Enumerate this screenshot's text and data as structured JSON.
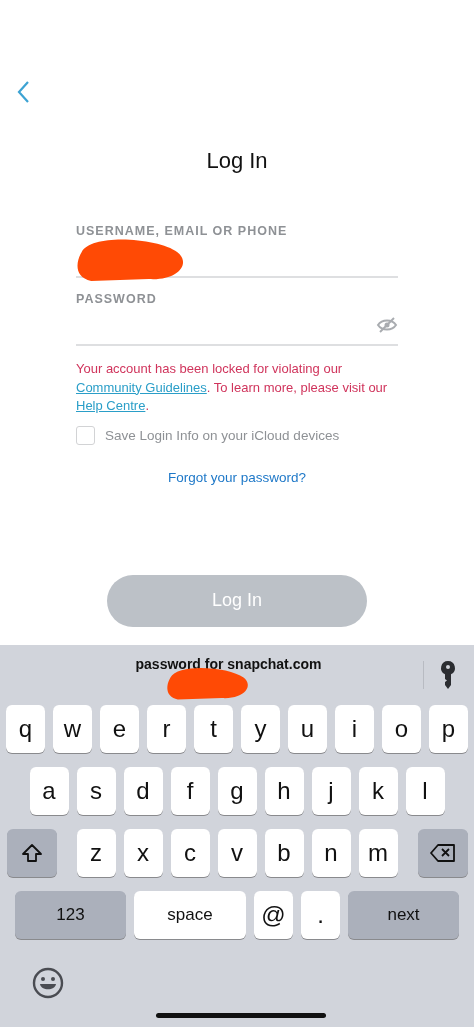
{
  "title": "Log In",
  "username": {
    "label": "USERNAME, EMAIL OR PHONE",
    "redacted": true
  },
  "password": {
    "label": "PASSWORD",
    "visible": false
  },
  "error": {
    "parts": [
      {
        "kind": "text",
        "text": "Your account has been locked for violating our "
      },
      {
        "kind": "link",
        "text": "Community Guidelines"
      },
      {
        "kind": "text",
        "text": ". To learn more, please visit our "
      },
      {
        "kind": "link",
        "text": "Help Centre"
      },
      {
        "kind": "text",
        "text": "."
      }
    ]
  },
  "save_login": {
    "label": "Save Login Info on your iCloud devices",
    "checked": false
  },
  "forgot_link": "Forgot your password?",
  "login_button": {
    "label": "Log In",
    "disabled": true
  },
  "keyboard": {
    "suggestion": "password for snapchat.com",
    "suggestion_redacted": true,
    "rows": [
      [
        {
          "kind": "letter",
          "label": "q"
        },
        {
          "kind": "letter",
          "label": "w"
        },
        {
          "kind": "letter",
          "label": "e"
        },
        {
          "kind": "letter",
          "label": "r"
        },
        {
          "kind": "letter",
          "label": "t"
        },
        {
          "kind": "letter",
          "label": "y"
        },
        {
          "kind": "letter",
          "label": "u"
        },
        {
          "kind": "letter",
          "label": "i"
        },
        {
          "kind": "letter",
          "label": "o"
        },
        {
          "kind": "letter",
          "label": "p"
        }
      ],
      [
        {
          "kind": "letter",
          "label": "a"
        },
        {
          "kind": "letter",
          "label": "s"
        },
        {
          "kind": "letter",
          "label": "d"
        },
        {
          "kind": "letter",
          "label": "f"
        },
        {
          "kind": "letter",
          "label": "g"
        },
        {
          "kind": "letter",
          "label": "h"
        },
        {
          "kind": "letter",
          "label": "j"
        },
        {
          "kind": "letter",
          "label": "k"
        },
        {
          "kind": "letter",
          "label": "l"
        }
      ],
      [
        {
          "kind": "shift"
        },
        {
          "kind": "letter",
          "label": "z"
        },
        {
          "kind": "letter",
          "label": "x"
        },
        {
          "kind": "letter",
          "label": "c"
        },
        {
          "kind": "letter",
          "label": "v"
        },
        {
          "kind": "letter",
          "label": "b"
        },
        {
          "kind": "letter",
          "label": "n"
        },
        {
          "kind": "letter",
          "label": "m"
        },
        {
          "kind": "delete"
        }
      ]
    ],
    "bottom_keys": [
      {
        "kind": "function",
        "label": "123"
      },
      {
        "kind": "space",
        "label": "space"
      },
      {
        "kind": "letter",
        "label": "@"
      },
      {
        "kind": "letter",
        "label": "."
      },
      {
        "kind": "function",
        "label": "next"
      }
    ]
  }
}
